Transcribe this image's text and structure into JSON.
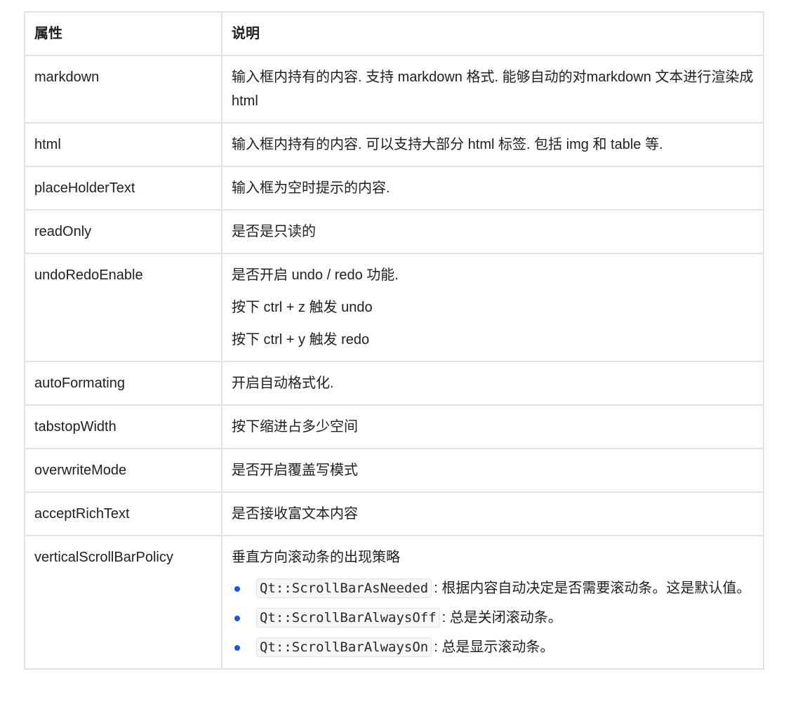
{
  "table": {
    "headers": [
      "属性",
      "说明"
    ],
    "rows": [
      {
        "property": "markdown",
        "description": [
          "输入框内持有的内容. 支持 markdown 格式. 能够自动的对markdown 文本进行渲染成 html"
        ]
      },
      {
        "property": "html",
        "description": [
          "输入框内持有的内容. 可以支持大部分 html 标签. 包括 img 和 table 等."
        ]
      },
      {
        "property": "placeHolderText",
        "description": [
          "输入框为空时提示的内容."
        ]
      },
      {
        "property": "readOnly",
        "description": [
          "是否是只读的"
        ]
      },
      {
        "property": "undoRedoEnable",
        "description": [
          "是否开启 undo / redo 功能.",
          "按下 ctrl + z 触发 undo",
          "按下 ctrl + y 触发 redo"
        ]
      },
      {
        "property": "autoFormating",
        "description": [
          "开启自动格式化."
        ]
      },
      {
        "property": "tabstopWidth",
        "description": [
          "按下缩进占多少空间"
        ]
      },
      {
        "property": "overwriteMode",
        "description": [
          "是否开启覆盖写模式"
        ]
      },
      {
        "property": "acceptRichText",
        "description": [
          "是否接收富文本内容"
        ]
      },
      {
        "property": "verticalScrollBarPolicy",
        "description": [
          "垂直方向滚动条的出现策略"
        ],
        "options": [
          {
            "code": "Qt::ScrollBarAsNeeded",
            "text": ": 根据内容自动决定是否需要滚动条。这是默认值。"
          },
          {
            "code": "Qt::ScrollBarAlwaysOff",
            "text": ": 总是关闭滚动条。"
          },
          {
            "code": "Qt::ScrollBarAlwaysOn",
            "text": ": 总是显示滚动条。"
          }
        ]
      }
    ]
  },
  "colors": {
    "border": "#e3e3e3",
    "bullet": "#1a56db",
    "code_background": "#f5f6f7"
  }
}
